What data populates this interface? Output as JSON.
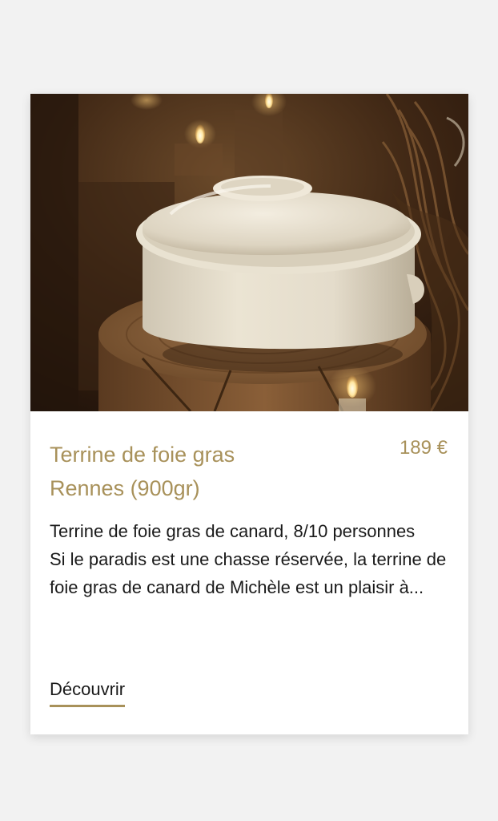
{
  "colors": {
    "accent": "#a8915a",
    "background": "#f2f2f2",
    "card": "#ffffff",
    "text": "#1a1a1a"
  },
  "product": {
    "image_alt": "Terrine de foie gras en porcelaine blanche posée sur une bûche de bois, bougies en arrière-plan",
    "title": "Terrine de foie gras Rennes (900gr)",
    "price": "189 €",
    "description_line1": "Terrine de foie gras de canard, 8/10 personnes",
    "description_line2": "Si le paradis est une chasse réservée, la terrine de foie gras de canard de Michèle est un plaisir à...",
    "cta_label": "Découvrir"
  }
}
